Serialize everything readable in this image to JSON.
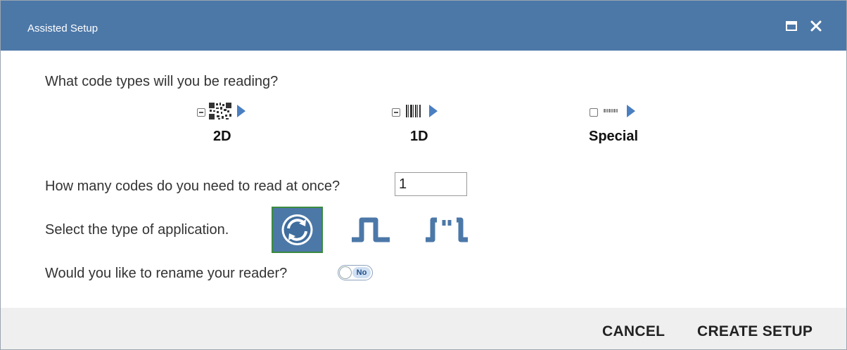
{
  "window": {
    "title": "Assisted Setup",
    "accent_color": "#4c78a8",
    "controls": [
      "maximize-icon",
      "close-icon"
    ]
  },
  "code_types": {
    "question": "What code types will you be reading?",
    "items": [
      {
        "label": "2D",
        "state": "mixed",
        "icon": "qr-code-icon"
      },
      {
        "label": "1D",
        "state": "mixed",
        "icon": "barcode-icon"
      },
      {
        "label": "Special",
        "state": "unchecked",
        "icon": "special-code-icon"
      }
    ]
  },
  "count": {
    "question": "How many codes do you need to read at once?",
    "value": "1"
  },
  "application": {
    "question": "Select the type of application.",
    "options": [
      {
        "icon": "continuous-icon",
        "selected": true
      },
      {
        "icon": "triggered-icon",
        "selected": false
      },
      {
        "icon": "multi-trigger-icon",
        "selected": false
      }
    ]
  },
  "rename": {
    "question": "Would you like to rename your reader?",
    "toggle_label": "No"
  },
  "footer": {
    "cancel_label": "CANCEL",
    "create_label": "CREATE SETUP"
  }
}
